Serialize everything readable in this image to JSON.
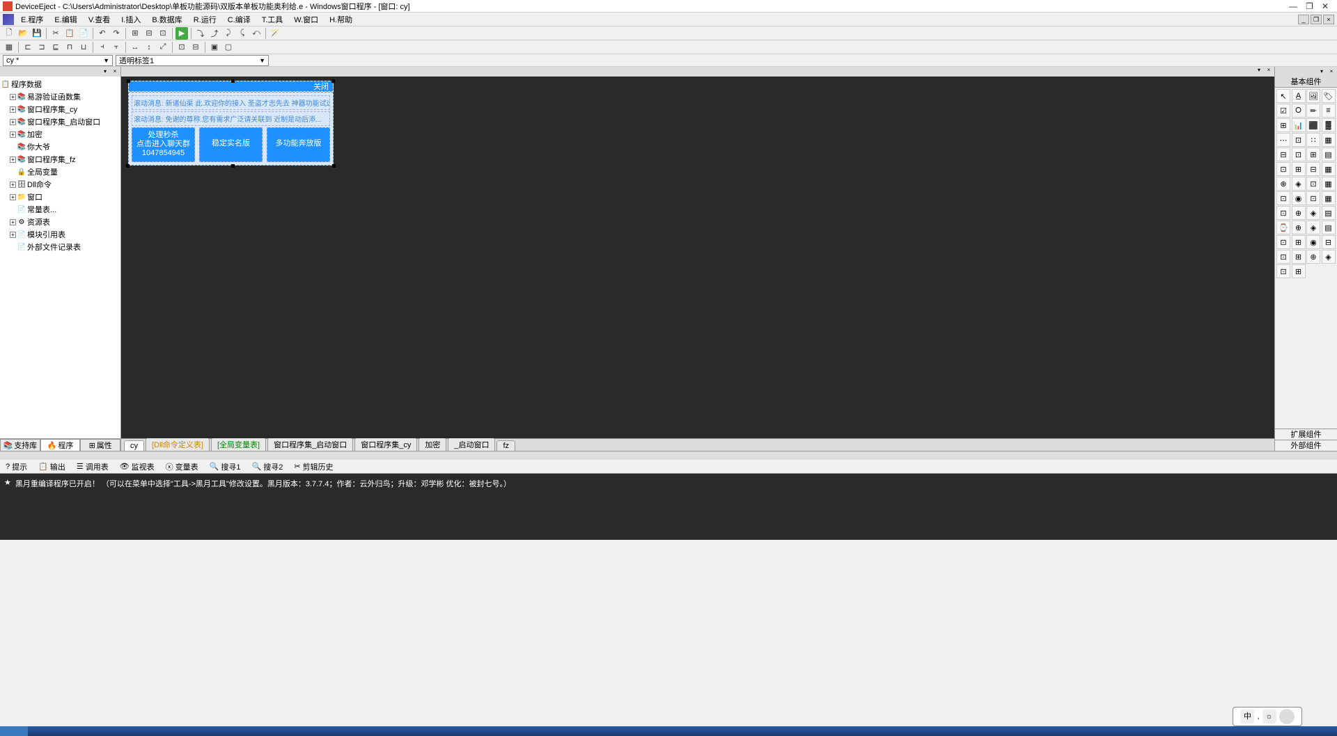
{
  "title": "DeviceEject - C:\\Users\\Administrator\\Desktop\\单板功能源码\\双版本单板功能奥利给.e - Windows窗口程序 - [窗口: cy]",
  "menus": [
    "E.程序",
    "E.编辑",
    "V.查看",
    "I.插入",
    "B.数据库",
    "R.运行",
    "C.编译",
    "T.工具",
    "W.窗口",
    "H.帮助"
  ],
  "combo1": "cy *",
  "combo2": "透明标签1",
  "tree_root": "程序数据",
  "tree_items": [
    {
      "label": "易游验证函数集",
      "level": 1,
      "icon": "books",
      "expand": "+"
    },
    {
      "label": "窗口程序集_cy",
      "level": 1,
      "icon": "books",
      "expand": "+"
    },
    {
      "label": "窗口程序集_启动窗口",
      "level": 1,
      "icon": "books",
      "expand": "+"
    },
    {
      "label": "加密",
      "level": 1,
      "icon": "books",
      "expand": "+"
    },
    {
      "label": "你大爷",
      "level": 1,
      "icon": "books",
      "expand": ""
    },
    {
      "label": "窗口程序集_fz",
      "level": 1,
      "icon": "books",
      "expand": "+"
    },
    {
      "label": "全局变量",
      "level": 1,
      "icon": "lock",
      "expand": ""
    },
    {
      "label": "Dll命令",
      "level": 1,
      "icon": "db",
      "expand": "+"
    },
    {
      "label": "窗口",
      "level": 1,
      "icon": "folder",
      "expand": "+"
    },
    {
      "label": "常量表...",
      "level": 1,
      "icon": "page",
      "expand": ""
    },
    {
      "label": "资源表",
      "level": 1,
      "icon": "gear",
      "expand": "+"
    },
    {
      "label": "模块引用表",
      "level": 1,
      "icon": "page",
      "expand": "+"
    },
    {
      "label": "外部文件记录表",
      "level": 1,
      "icon": "page",
      "expand": ""
    }
  ],
  "left_tabs": [
    "支持库",
    "程序",
    "属性"
  ],
  "form": {
    "close_label": "关闭",
    "tag1": "滚动消息: 新诸仙渠 此.欢迎你的接入 圣盗才志先去 神器功能试这版",
    "tag2": "滚动消息: 免谢的尊称.您有需求广泛请关联到 近制是动后添...",
    "btn1_l1": "处理秒杀",
    "btn1_l2": "点击进入聊天群",
    "btn1_l3": "1047854945",
    "btn2": "稳定实名版",
    "btn3": "多功能奔放版"
  },
  "editor_tabs": [
    {
      "label": "cy",
      "cls": "active"
    },
    {
      "label": "[Dll命令定义表]",
      "cls": "yellow"
    },
    {
      "label": "[全局变量表]",
      "cls": "green"
    },
    {
      "label": "窗口程序集_启动窗口",
      "cls": ""
    },
    {
      "label": "窗口程序集_cy",
      "cls": ""
    },
    {
      "label": "加密",
      "cls": ""
    },
    {
      "label": "_启动窗口",
      "cls": ""
    },
    {
      "label": "fz",
      "cls": ""
    }
  ],
  "right_title": "基本组件",
  "right_bottom": [
    "扩展组件",
    "外部组件"
  ],
  "bottom_tabs": [
    "提示",
    "输出",
    "调用表",
    "监视表",
    "变量表",
    "搜寻1",
    "搜寻2",
    "剪辑历史"
  ],
  "console_text": "黑月重编译程序已开启！ （可以在菜单中选择\"工具->黑月工具\"修改设置。黑月版本：3.7.7.4；作者：云外归鸟；升级：邓学彬 优化：被封七号。）",
  "ime": {
    "char1": "中",
    "char2": "☼"
  },
  "tool_icons": [
    "↖",
    "A̲",
    "🖼",
    "🏷",
    "☑",
    "⭘",
    "✏",
    "≡",
    "⊞",
    "📊",
    "⬛",
    "▓",
    "⋯",
    "⊡",
    "∷",
    "▦",
    "⊟",
    "⊡",
    "⊞",
    "▤",
    "⊡",
    "⊞",
    "⊟",
    "▦",
    "⊕",
    "◈",
    "⊡",
    "▦",
    "⊡",
    "◉",
    "⊡",
    "▦",
    "⊡",
    "⊕",
    "◈",
    "▤",
    "⌚",
    "⊕",
    "◈",
    "▤",
    "⊡",
    "⊞",
    "◉",
    "⊟",
    "⊡",
    "⊞",
    "⊕",
    "◈",
    "⊡",
    "⊞"
  ]
}
